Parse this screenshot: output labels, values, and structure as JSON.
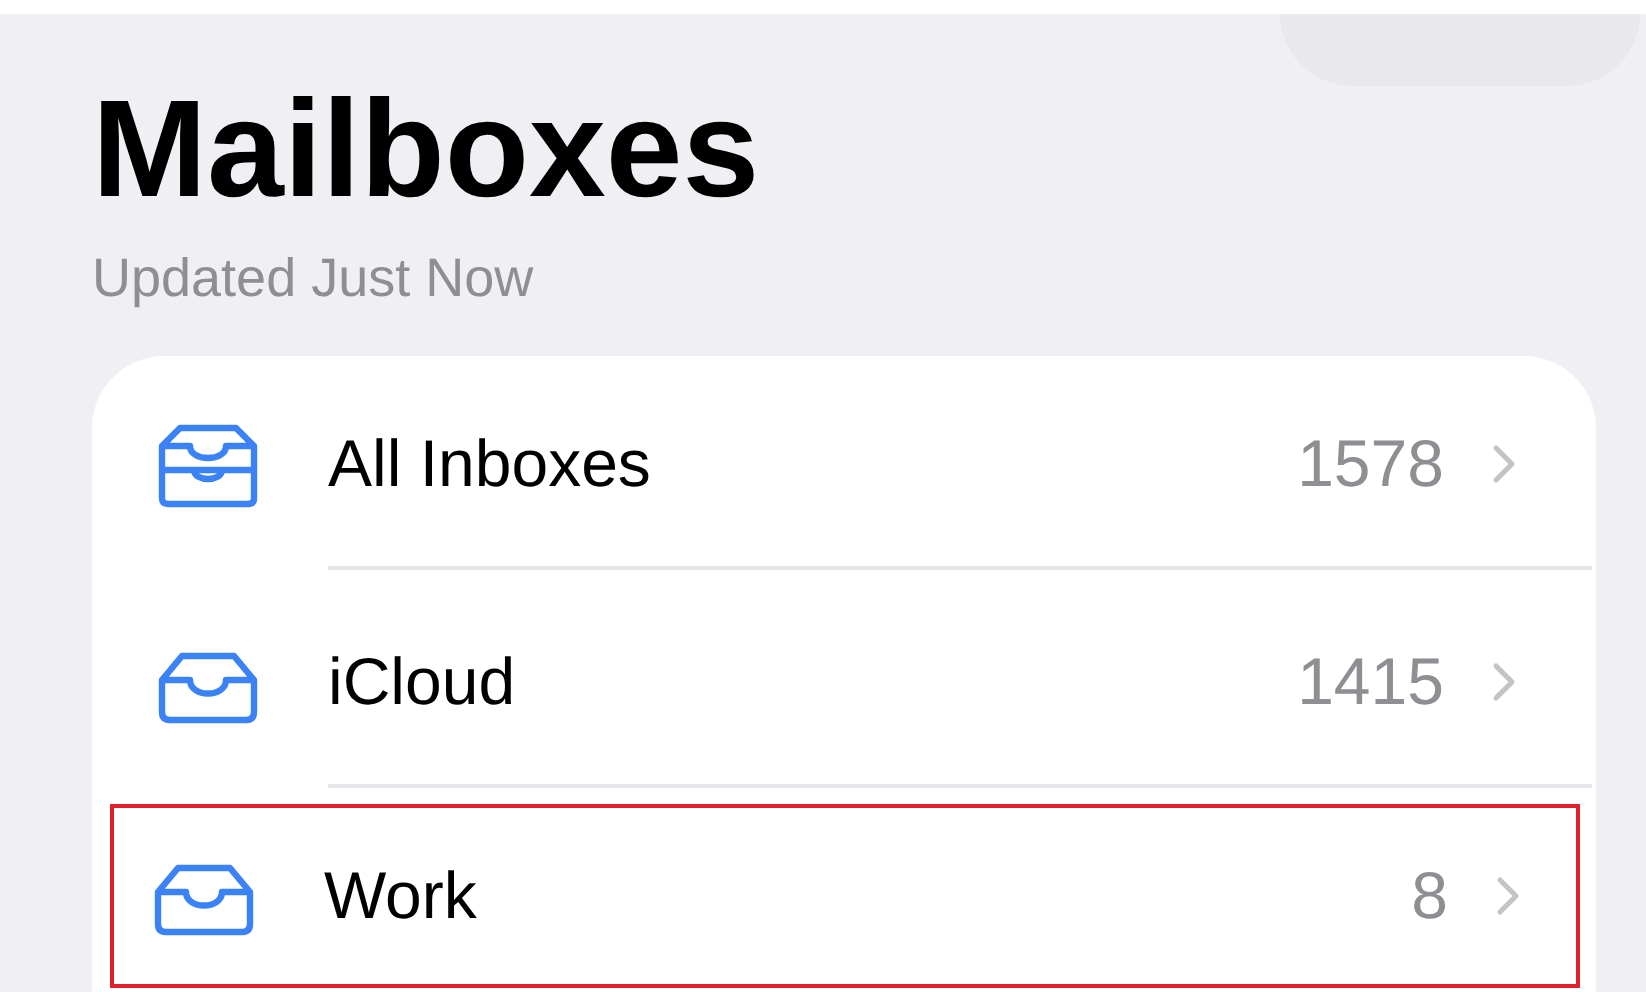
{
  "header": {
    "title": "Mailboxes",
    "subtitle": "Updated Just Now"
  },
  "mailboxes": [
    {
      "kind": "all",
      "name": "All Inboxes",
      "count": "1578",
      "highlighted": false
    },
    {
      "kind": "account",
      "name": "iCloud",
      "count": "1415",
      "highlighted": false
    },
    {
      "kind": "account",
      "name": "Work",
      "count": "8",
      "highlighted": true
    }
  ]
}
